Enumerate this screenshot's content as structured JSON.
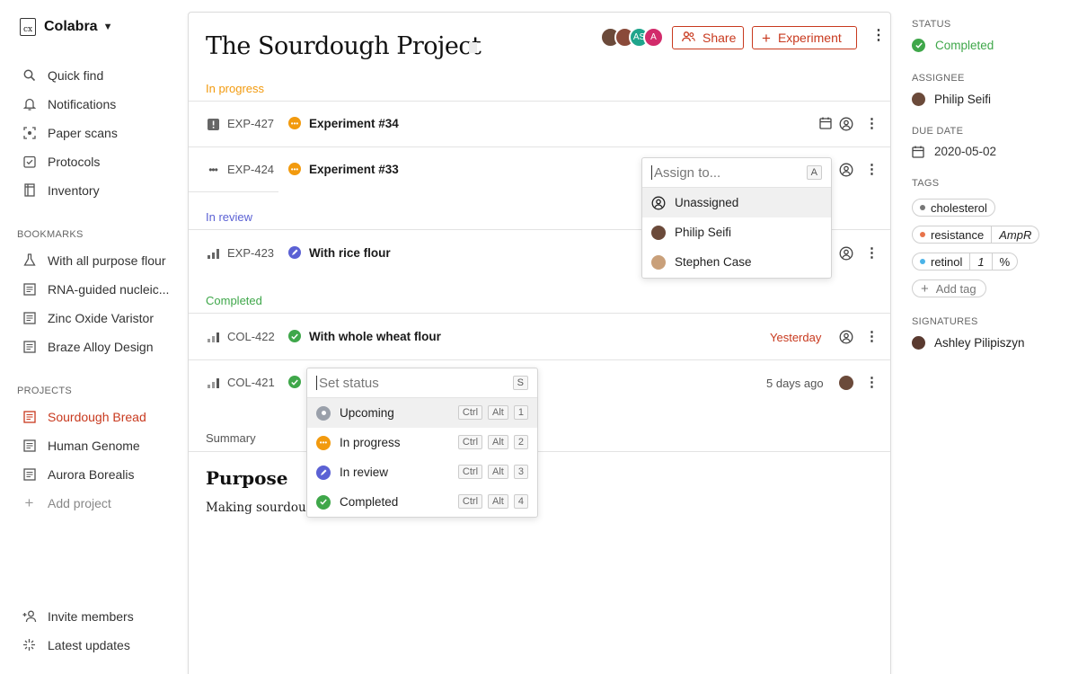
{
  "workspace": {
    "name": "Colabra"
  },
  "nav": {
    "quick_find": "Quick find",
    "notifications": "Notifications",
    "paper_scans": "Paper scans",
    "protocols": "Protocols",
    "inventory": "Inventory"
  },
  "bookmarks": {
    "label": "BOOKMARKS",
    "items": [
      "With all purpose flour",
      "RNA-guided nucleic...",
      "Zinc Oxide Varistor",
      "Braze Alloy Design"
    ]
  },
  "projects": {
    "label": "PROJECTS",
    "items": [
      "Sourdough Bread",
      "Human Genome",
      "Aurora Borealis"
    ],
    "add": "Add project"
  },
  "footer": {
    "invite": "Invite members",
    "updates": "Latest updates"
  },
  "main": {
    "title": "The Sourdough Project",
    "avatars": [
      {
        "initials": "",
        "color": "#6b4a3a"
      },
      {
        "initials": "",
        "color": "#8a4a3a"
      },
      {
        "initials": "AS",
        "color": "#1fa58c"
      },
      {
        "initials": "A",
        "color": "#d22b6b"
      }
    ],
    "share_label": "Share",
    "experiment_label": "Experiment",
    "groups": {
      "in_progress": "In progress",
      "in_review": "In review",
      "completed": "Completed"
    },
    "rows": [
      {
        "id": "EXP-427",
        "name": "Experiment #34",
        "date": ""
      },
      {
        "id": "EXP-424",
        "name": "Experiment #33",
        "date": ""
      },
      {
        "id": "EXP-423",
        "name": "With rice flour",
        "date": ""
      },
      {
        "id": "COL-422",
        "name": "With whole wheat flour",
        "date": "Yesterday"
      },
      {
        "id": "COL-421",
        "name": "",
        "date": "5 days ago"
      }
    ],
    "summary_label": "Summary",
    "purpose_heading": "Purpose",
    "purpose_text": "Making sourdough"
  },
  "assign_popup": {
    "placeholder": "Assign to...",
    "shortcut": "A",
    "options": [
      "Unassigned",
      "Philip Seifi",
      "Stephen Case"
    ]
  },
  "status_popup": {
    "placeholder": "Set status",
    "shortcut": "S",
    "options": [
      {
        "label": "Upcoming",
        "keys": [
          "Ctrl",
          "Alt",
          "1"
        ]
      },
      {
        "label": "In progress",
        "keys": [
          "Ctrl",
          "Alt",
          "2"
        ]
      },
      {
        "label": "In review",
        "keys": [
          "Ctrl",
          "Alt",
          "3"
        ]
      },
      {
        "label": "Completed",
        "keys": [
          "Ctrl",
          "Alt",
          "4"
        ]
      }
    ]
  },
  "properties": {
    "status_label": "STATUS",
    "status_value": "Completed",
    "assignee_label": "ASSIGNEE",
    "assignee_value": "Philip Seifi",
    "due_label": "DUE DATE",
    "due_value": "2020-05-02",
    "tags_label": "TAGS",
    "tags": [
      {
        "name": "cholesterol",
        "value": "",
        "unit": "",
        "color": "#777777"
      },
      {
        "name": "resistance",
        "value": "AmpR",
        "unit": "",
        "color": "#e8734a"
      },
      {
        "name": "retinol",
        "value": "1",
        "unit": "%",
        "color": "#4ab3e8"
      }
    ],
    "add_tag": "Add tag",
    "signatures_label": "SIGNATURES",
    "signature_value": "Ashley Pilipiszyn"
  },
  "colors": {
    "accent": "#c8391e",
    "in_progress": "#f29a0e",
    "in_review": "#5b61d4",
    "completed": "#3fa74a",
    "upcoming": "#9aa0aa"
  }
}
